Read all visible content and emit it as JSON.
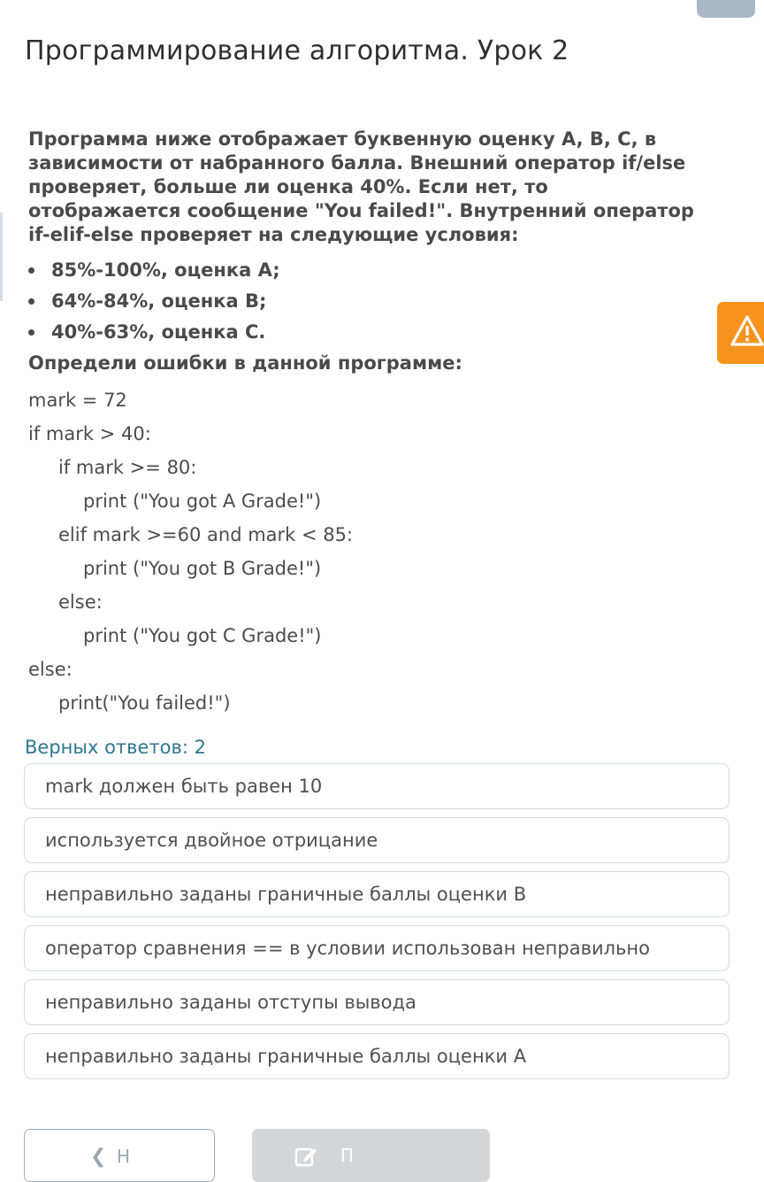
{
  "lesson": {
    "title": "Программирование алгоритма. Урок 2"
  },
  "question": {
    "intro": "Программа ниже отображает буквенную оценку A, B, C, в зависимости от набранного балла. Внешний оператор if/else проверяет, больше ли оценка 40%. Если нет, то отображается сообщение \"You failed!\". Внутренний оператор if-elif-else проверяет на следующие условия:",
    "conditions": [
      "85%-100%, оценка A;",
      "64%-84%, оценка B;",
      "40%-63%, оценка C."
    ],
    "task": "Определи ошибки в данной программе:",
    "code": [
      "mark = 72",
      "if mark > 40:",
      "if mark >= 80:",
      "print (\"You got A Grade!\")",
      "elif mark >=60 and mark < 85:",
      "print (\"You got B Grade!\")",
      "else:",
      "print (\"You got C Grade!\")",
      "else:",
      "print(\"You failed!\")"
    ]
  },
  "answers": {
    "counter": "Верных ответов: 2",
    "options": [
      "mark должен быть равен 10",
      "используется двойное отрицание",
      "неправильно заданы граничные баллы оценки В",
      "оператор сравнения == в условии использован неправильно",
      "неправильно заданы отступы вывода",
      "неправильно заданы граничные баллы оценки А"
    ]
  },
  "footer": {
    "back_label": "Н",
    "submit_label": "П"
  },
  "icons": {
    "report": "warning-triangle-icon",
    "back": "chevron-left-icon",
    "submit": "edit-icon"
  },
  "colors": {
    "accent": "#2d7891",
    "report_tab": "#f6921e",
    "submit_disabled": "#d3d7da",
    "border": "#d5dbe0"
  }
}
